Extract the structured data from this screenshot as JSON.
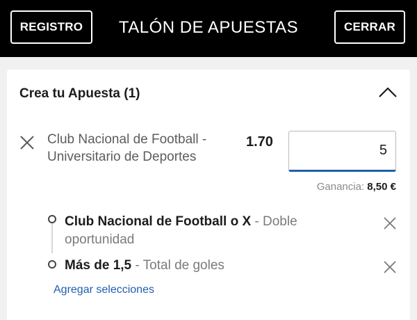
{
  "header": {
    "registro_label": "REGISTRO",
    "title": "TALÓN DE APUESTAS",
    "cerrar_label": "CERRAR"
  },
  "betslip": {
    "section_title": "Crea tu Apuesta (1)",
    "match_line1": "Club Nacional de Football -",
    "match_line2": "Universitario de Deportes",
    "odds": "1.70",
    "stake_value": "5",
    "ganancia_label": "Ganancia:",
    "ganancia_value": "8,50 €",
    "selections": [
      {
        "name": "Club Nacional de Football o X",
        "type_line1": " - Doble",
        "type_line2": "oportunidad"
      },
      {
        "name": "Más de 1,5",
        "type": " - Total de goles"
      }
    ],
    "add_link": "Agregar selecciones"
  },
  "icons": {
    "collapse": "chevron-up-icon",
    "remove": "close-icon",
    "timeline": "circle-icon"
  },
  "colors": {
    "header_bg": "#000000",
    "accent_blue": "#1f5fae",
    "background": "#f1f1f1"
  }
}
